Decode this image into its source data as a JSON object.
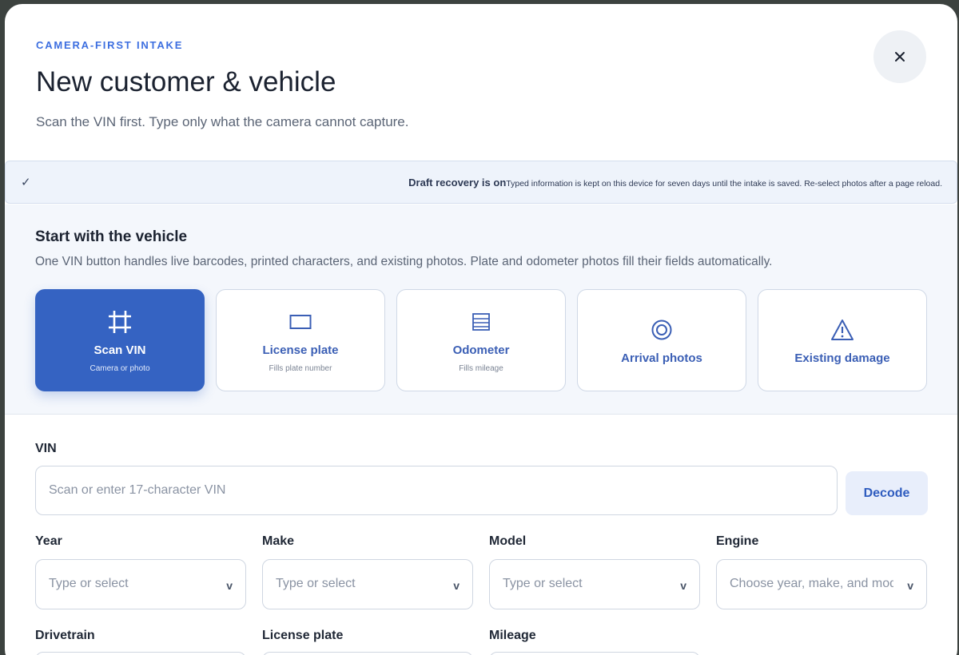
{
  "header": {
    "eyebrow": "CAMERA-FIRST INTAKE",
    "title": "New customer & vehicle",
    "subtitle": "Scan the VIN first. Type only what the camera cannot capture."
  },
  "close_icon": "close-icon",
  "draft": {
    "check": "✓",
    "title": "Draft recovery is on",
    "text": "Typed information is kept on this device for seven days until the intake is saved. Re-select photos after a page reload."
  },
  "vehicle_section": {
    "title": "Start with the vehicle",
    "description": "One VIN button handles live barcodes, printed characters, and existing photos. Plate and odometer photos fill their fields automatically.",
    "tiles": [
      {
        "label": "Scan VIN",
        "sub": "Camera or photo",
        "icon": "scan-icon",
        "active": true
      },
      {
        "label": "License plate",
        "sub": "Fills plate number",
        "icon": "plate-icon",
        "active": false
      },
      {
        "label": "Odometer",
        "sub": "Fills mileage",
        "icon": "odometer-icon",
        "active": false
      },
      {
        "label": "Arrival photos",
        "sub": "",
        "icon": "camera-target-icon",
        "active": false
      },
      {
        "label": "Existing damage",
        "sub": "",
        "icon": "warning-icon",
        "active": false
      }
    ]
  },
  "form": {
    "vin": {
      "label": "VIN",
      "placeholder": "Scan or enter 17-character VIN",
      "value": "",
      "decode_label": "Decode"
    },
    "selects": [
      {
        "label": "Year",
        "placeholder": "Type or select",
        "chevron": "v"
      },
      {
        "label": "Make",
        "placeholder": "Type or select",
        "chevron": "v"
      },
      {
        "label": "Model",
        "placeholder": "Type or select",
        "chevron": "v"
      },
      {
        "label": "Engine",
        "placeholder": "Choose year, make, and model",
        "chevron": "v"
      }
    ],
    "row3_labels": [
      "Drivetrain",
      "License plate",
      "Mileage"
    ]
  },
  "colors": {
    "accent": "#3563c2",
    "eyebrow": "#3d6fe0",
    "banner_bg": "#eef3fb",
    "section_bg": "#f4f7fc"
  }
}
